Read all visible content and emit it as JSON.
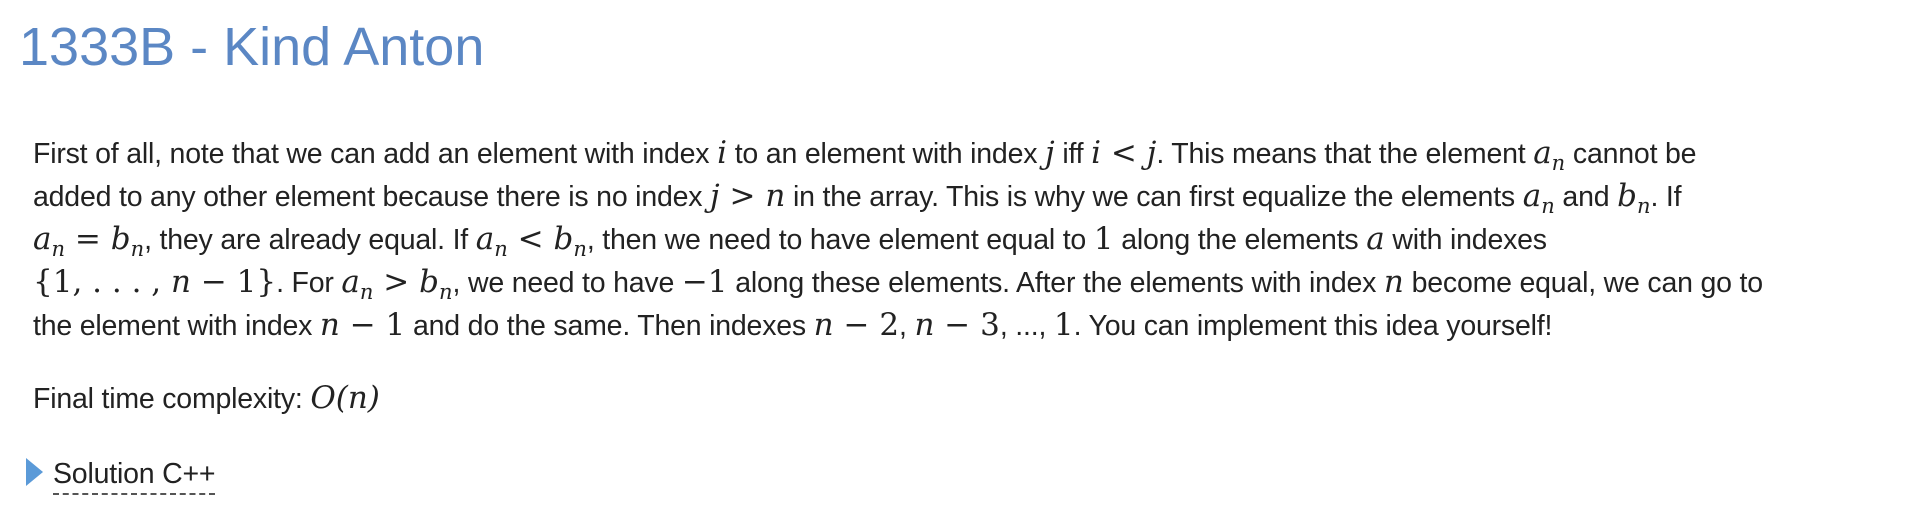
{
  "title": "1333B - Kind Anton",
  "editorial": {
    "line1": {
      "t1": "First of all, note that we can add an element with index ",
      "m1": "i",
      "t2": " to an element with index ",
      "m2": "j",
      "t3": " iff ",
      "m3": "i < j",
      "t4": ". This means that the element ",
      "m4_base": "a",
      "m4_sub": "n",
      "t5": " cannot be"
    },
    "line2": {
      "t1": "added to any other element because there is no index ",
      "m1": "j > n",
      "t2": " in the array. This is why we can first equalize the elements ",
      "m2_base": "a",
      "m2_sub": "n",
      "t3": " and ",
      "m3_base": "b",
      "m3_sub": "n",
      "t4": ". If"
    },
    "line3": {
      "m1_base": "a",
      "m1_sub": "n",
      "m1_op": " = ",
      "m2_base": "b",
      "m2_sub": "n",
      "t1": ", they are already equal. If ",
      "m3_base": "a",
      "m3_sub": "n",
      "m3_op": " < ",
      "m4_base": "b",
      "m4_sub": "n",
      "t2": ", then we need to have element equal to ",
      "m5": "1",
      "t3": " along the elements ",
      "m6": "a",
      "t4": " with indexes"
    },
    "line4": {
      "m1_open": "{1, . . . , ",
      "m1_n": "n",
      "m1_close": " − 1}",
      "t1": ". For ",
      "m2_base": "a",
      "m2_sub": "n",
      "m2_op": " > ",
      "m3_base": "b",
      "m3_sub": "n",
      "t2": ", we need to have ",
      "m4": "−1",
      "t3": " along these elements. After the elements with index ",
      "m5": "n",
      "t4": " become equal, we can go to"
    },
    "line5": {
      "t1": "the element with index ",
      "m1_n": "n",
      "m1_rest": " − 1",
      "t2": " and do the same. Then indexes ",
      "m2_n": "n",
      "m2_rest": " − 2",
      "t3": ", ",
      "m3_n": "n",
      "m3_rest": " − 3",
      "t4": ", ..., ",
      "m4": "1",
      "t5": ". You can implement this idea yourself!"
    }
  },
  "complexity": {
    "label": "Final time complexity: ",
    "value": "O(n)"
  },
  "spoiler": {
    "icon": "triangle-right-icon",
    "label": "Solution C++"
  },
  "colors": {
    "title": "#5b87c4",
    "text": "#222222",
    "arrow": "#5b9ad8"
  }
}
